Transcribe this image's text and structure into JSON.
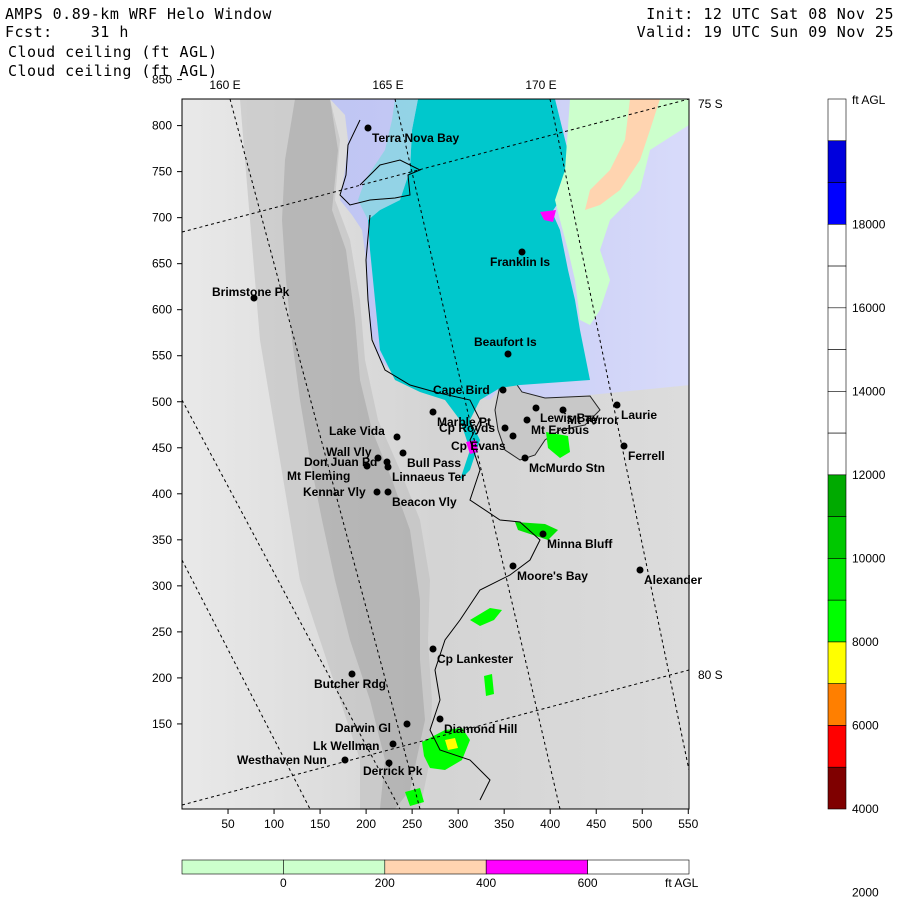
{
  "header": {
    "title": "AMPS 0.89-km WRF Helo Window",
    "forecast_label": "Fcst:",
    "forecast_hours": "31 h",
    "field_line_1": "Cloud ceiling (ft AGL)",
    "field_line_2": "Cloud ceiling (ft AGL)",
    "init": "Init: 12 UTC Sat 08 Nov 25",
    "valid": "Valid: 19 UTC Sun 09 Nov 25"
  },
  "lon_labels": [
    "160 E",
    "165 E",
    "170 E"
  ],
  "lat_labels": [
    "75 S",
    "80 S"
  ],
  "x_ticks": [
    "50",
    "100",
    "150",
    "200",
    "250",
    "300",
    "350",
    "400",
    "450",
    "500",
    "550"
  ],
  "y_ticks": [
    "850",
    "800",
    "750",
    "700",
    "650",
    "600",
    "550",
    "500",
    "450",
    "400",
    "350",
    "300",
    "250",
    "200",
    "150"
  ],
  "right_colorbar": {
    "unit": "ft AGL",
    "labels": [
      "18000",
      "16000",
      "14000",
      "12000",
      "10000",
      "8000",
      "6000",
      "4000",
      "2000"
    ],
    "colors": [
      "#ffffff",
      "#0000dd",
      "#0000ff",
      "#ffffff",
      "#ffffff",
      "#ffffff",
      "#ffffff",
      "#ffffff",
      "#ffffff",
      "#00aa00",
      "#00c800",
      "#00e600",
      "#00ff00",
      "#ffff00",
      "#ff7f00",
      "#ff0000",
      "#7f0000"
    ]
  },
  "bottom_colorbar": {
    "unit": "ft AGL",
    "labels": [
      "0",
      "200",
      "400",
      "600"
    ],
    "colors": [
      "#ccffcc",
      "#ccffcc",
      "#ffd4b0",
      "#ff00ff",
      "#ffffff"
    ]
  },
  "places": [
    {
      "name": "Terra Nova Bay",
      "x": 368,
      "y": 128
    },
    {
      "name": "Franklin Is",
      "x": 522,
      "y": 252
    },
    {
      "name": "Brimstone Pk",
      "x": 254,
      "y": 298
    },
    {
      "name": "Beaufort Is",
      "x": 508,
      "y": 354
    },
    {
      "name": "Cape Bird",
      "x": 503,
      "y": 390
    },
    {
      "name": "Lewis Bay",
      "x": 536,
      "y": 408
    },
    {
      "name": "Laurie",
      "x": 617,
      "y": 405
    },
    {
      "name": "Mt Terror",
      "x": 563,
      "y": 410
    },
    {
      "name": "Marble Pt",
      "x": 433,
      "y": 412
    },
    {
      "name": "Mt Erebus",
      "x": 527,
      "y": 420
    },
    {
      "name": "Cp Royds",
      "x": 505,
      "y": 428
    },
    {
      "name": "Lake Vida",
      "x": 397,
      "y": 437
    },
    {
      "name": "Cp Evans",
      "x": 513,
      "y": 436
    },
    {
      "name": "Ferrell",
      "x": 624,
      "y": 446
    },
    {
      "name": "Wall Vly",
      "x": 378,
      "y": 458
    },
    {
      "name": "Bull Pass",
      "x": 403,
      "y": 453
    },
    {
      "name": "McMurdo Stn",
      "x": 525,
      "y": 458
    },
    {
      "name": "Don Juan Pd",
      "x": 387,
      "y": 462
    },
    {
      "name": "Mt Fleming",
      "x": 367,
      "y": 466
    },
    {
      "name": "Linnaeus Ter",
      "x": 388,
      "y": 467
    },
    {
      "name": "Kennar Vly",
      "x": 377,
      "y": 492
    },
    {
      "name": "Beacon Vly",
      "x": 388,
      "y": 492
    },
    {
      "name": "Minna Bluff",
      "x": 543,
      "y": 534
    },
    {
      "name": "Moore's Bay",
      "x": 513,
      "y": 566
    },
    {
      "name": "Alexander",
      "x": 640,
      "y": 570
    },
    {
      "name": "Cp Lankester",
      "x": 433,
      "y": 649
    },
    {
      "name": "Butcher Rdg",
      "x": 352,
      "y": 674
    },
    {
      "name": "Diamond Hill",
      "x": 440,
      "y": 719
    },
    {
      "name": "Darwin Gl",
      "x": 407,
      "y": 724
    },
    {
      "name": "Lk Wellman",
      "x": 393,
      "y": 744
    },
    {
      "name": "Westhaven Nun",
      "x": 345,
      "y": 760
    },
    {
      "name": "Derrick Pk",
      "x": 389,
      "y": 763
    }
  ]
}
